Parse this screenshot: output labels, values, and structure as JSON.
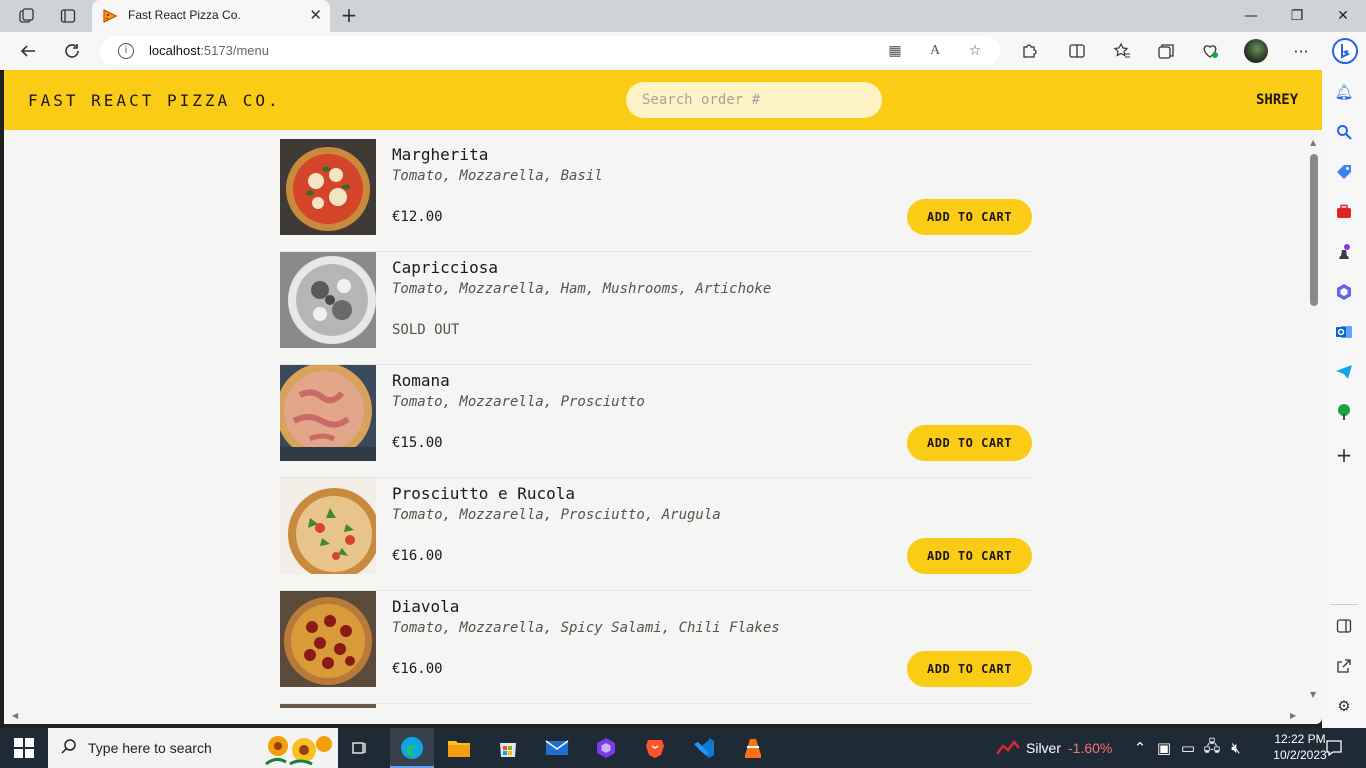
{
  "browser": {
    "tab_title": "Fast React Pizza Co.",
    "url_host": "localhost",
    "url_path": ":5173/menu",
    "theme": {
      "tabstrip": "#cfd3d8",
      "toolbar": "#f7f7f7"
    }
  },
  "header": {
    "logo": "FAST REACT PIZZA CO.",
    "search_placeholder": "Search order #",
    "username": "SHREY",
    "color": "#facc15"
  },
  "menu": {
    "add_label": "ADD TO CART",
    "sold_out_label": "SOLD OUT",
    "items": [
      {
        "name": "Margherita",
        "ingredients": "Tomato, Mozzarella, Basil",
        "price": "€12.00",
        "sold_out": false
      },
      {
        "name": "Capricciosa",
        "ingredients": "Tomato, Mozzarella, Ham, Mushrooms, Artichoke",
        "price": "",
        "sold_out": true
      },
      {
        "name": "Romana",
        "ingredients": "Tomato, Mozzarella, Prosciutto",
        "price": "€15.00",
        "sold_out": false
      },
      {
        "name": "Prosciutto e Rucola",
        "ingredients": "Tomato, Mozzarella, Prosciutto, Arugula",
        "price": "€16.00",
        "sold_out": false
      },
      {
        "name": "Diavola",
        "ingredients": "Tomato, Mozzarella, Spicy Salami, Chili Flakes",
        "price": "€16.00",
        "sold_out": false
      }
    ]
  },
  "taskbar": {
    "search_label": "Type here to search",
    "stock_name": "Silver",
    "stock_change": "-1.60%",
    "time": "12:22 PM",
    "date": "10/2/2023"
  }
}
